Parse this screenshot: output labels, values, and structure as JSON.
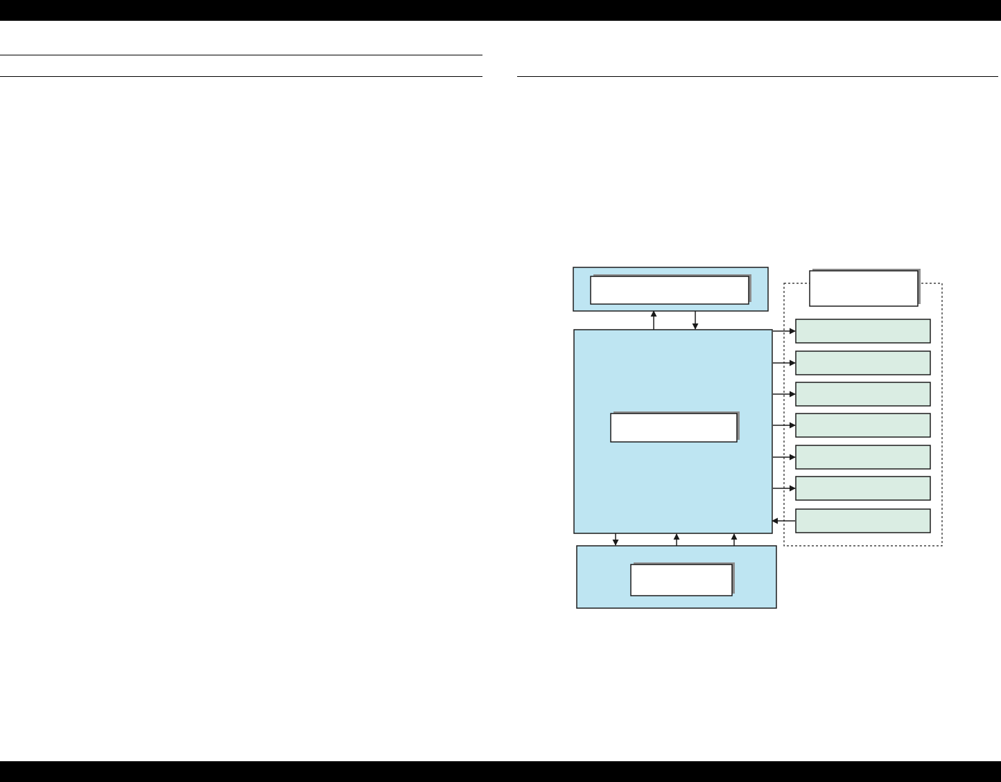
{
  "page": {
    "header_bar": "",
    "footer_bar": ""
  },
  "diagram": {
    "colors": {
      "block_fill": "#BEE5F2",
      "module_fill": "#DAEDE3",
      "inner_box_fill": "#FFFFFF",
      "shadow": "#8C8C8C",
      "stroke": "#1A1A1A"
    },
    "top_block": {
      "label": ""
    },
    "main_block": {
      "label": ""
    },
    "bottom_block": {
      "label": ""
    },
    "side_group": {
      "header": "",
      "modules": [
        {
          "label": "",
          "direction": "out"
        },
        {
          "label": "",
          "direction": "out"
        },
        {
          "label": "",
          "direction": "out"
        },
        {
          "label": "",
          "direction": "out"
        },
        {
          "label": "",
          "direction": "out"
        },
        {
          "label": "",
          "direction": "out"
        },
        {
          "label": "",
          "direction": "in"
        }
      ]
    }
  }
}
